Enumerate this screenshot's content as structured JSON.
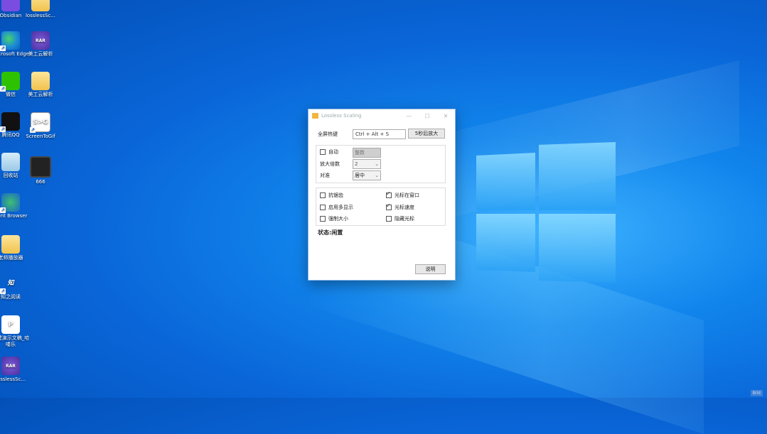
{
  "desktop_icons": [
    {
      "label": "Obsidian"
    },
    {
      "label": "losslessSc..."
    },
    {
      "label": "Microsoft Edge"
    },
    {
      "label": "美工云解析"
    },
    {
      "label": "微信"
    },
    {
      "label": "美工云解析"
    },
    {
      "label": "腾讯QQ"
    },
    {
      "label": "ScreenToGif",
      "glyph": "S>G"
    },
    {
      "label": "回收站"
    },
    {
      "label": "666"
    },
    {
      "label": "Cent Browser"
    },
    {
      "label": "老师播放器"
    },
    {
      "label": "知之阅读",
      "glyph": "知"
    },
    {
      "label": "新建演示文稿_哈喽乐"
    },
    {
      "label": "losslessSc...",
      "glyph": "RAR"
    }
  ],
  "rar_glyph": "RAR",
  "dialog": {
    "title": "Lossless Scaling",
    "minimize": "—",
    "maximize": "☐",
    "close": "✕",
    "hotkey_label": "全屏热键",
    "hotkey_value": "Ctrl + Alt + S",
    "zoom_button": "5秒后放大",
    "auto_label": "自动",
    "auto_value": "整数",
    "scale_label": "放大倍数",
    "scale_value": "2",
    "align_label": "对准",
    "align_value": "居中",
    "options": {
      "antialias": "抗锯齿",
      "multi_display": "启用多显示",
      "force_size": "强制大小",
      "cursor_in_window": "光标在窗口",
      "cursor_speed": "光标速度",
      "hide_cursor": "隐藏光标"
    },
    "status": "状态:闲置",
    "help_button": "说明"
  },
  "corner_badge": "Bild"
}
